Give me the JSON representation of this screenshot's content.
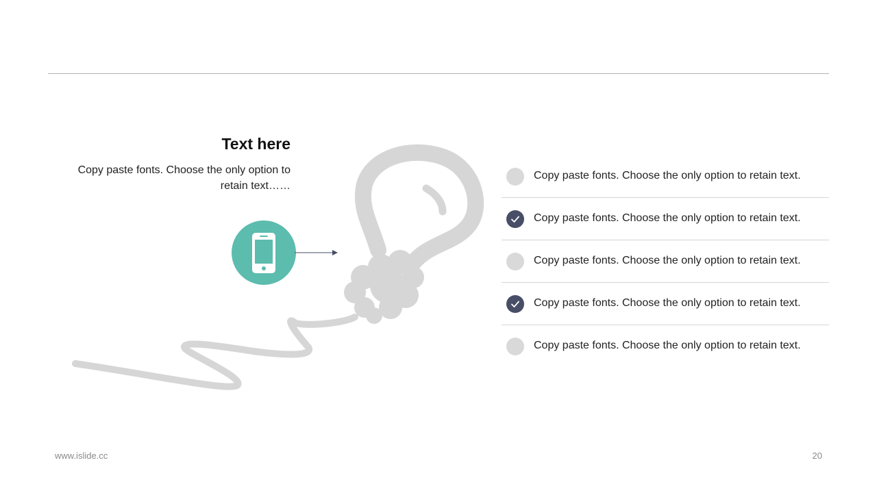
{
  "slide": {
    "title": "Text here",
    "description": "Copy paste fonts. Choose the only option to retain text……",
    "list": [
      {
        "text": "Copy paste fonts. Choose the only option to retain text.",
        "checked": false
      },
      {
        "text": "Copy paste fonts. Choose the only option to retain text.",
        "checked": true
      },
      {
        "text": "Copy paste fonts. Choose the only option to retain text.",
        "checked": false
      },
      {
        "text": "Copy paste fonts. Choose the only option to retain text.",
        "checked": true
      },
      {
        "text": "Copy paste fonts. Choose the only option to retain text.",
        "checked": false
      }
    ]
  },
  "footer": {
    "website": "www.islide.cc",
    "page_number": "20"
  },
  "icons": {
    "phone": "smartphone-icon",
    "bulb": "lightbulb-illustration",
    "arrow": "arrow-right-icon",
    "check": "check-icon"
  },
  "colors": {
    "accent_teal": "#5cbcae",
    "check_dark": "#474e66",
    "neutral_gray": "#d9d9d9",
    "bulb_gray": "#d6d6d6"
  }
}
